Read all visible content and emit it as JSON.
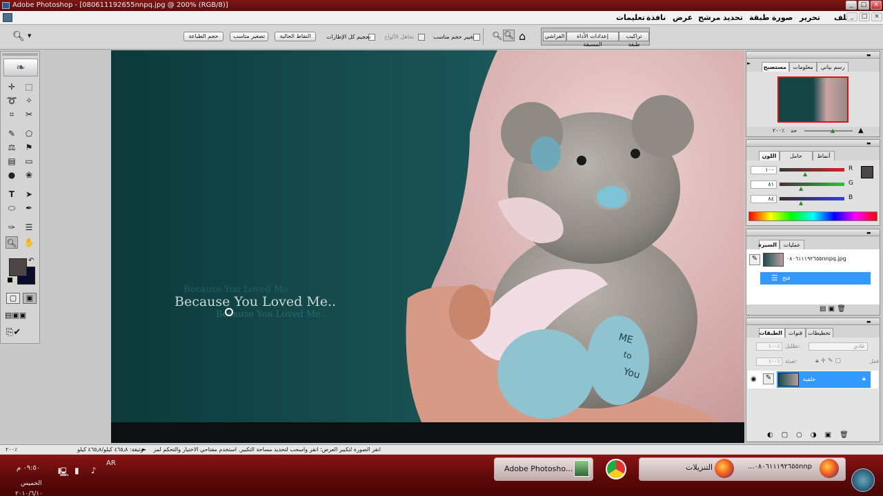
{
  "window": {
    "title": "Adobe Photoshop - [080611192655nnpq.jpg @ 200% (RGB/8)]",
    "min": "_",
    "max": "□",
    "close": "×"
  },
  "menu": {
    "items": [
      "ملف",
      "تحرير",
      "صورة",
      "طبقة",
      "تحديد",
      "مرشح",
      "عرض",
      "نافذة",
      "تعليمات"
    ]
  },
  "options": {
    "resize_windows_label": "تغيير حجم مناسب",
    "ignore_palettes_label": "تجاهل الألواح",
    "zoom_all_label": "تحجيم كل الإطارات",
    "actual_pixels": "النقاط الحالية",
    "fit_on_screen": "تصغير مناسب",
    "print_size": "حجم الطباعة",
    "tabs": [
      "تراكيب طبقة",
      "إعدادات الأداة المسبقة",
      "الفراشي"
    ]
  },
  "canvas": {
    "text_main": "Because You Loved Me..",
    "text_ghost_top": "Because You Loved Me..",
    "text_ghost_bottom": "Because You Loved Me.."
  },
  "navigator": {
    "tabs": [
      "مستصبح",
      "معلومات",
      "رسم بياني"
    ],
    "zoom": "٢٠٠٪",
    "zoom_label": "حد"
  },
  "color": {
    "tabs": [
      "اللون",
      "حامل الألوان",
      "أنماط"
    ],
    "r_label": "R",
    "r_value": "١٠٠",
    "g_label": "G",
    "g_value": "٨١",
    "b_label": "B",
    "b_value": "٨٤",
    "fg": "#4d4646",
    "bg": "#0b0b2c"
  },
  "history": {
    "tabs": [
      "السيرة",
      "عمليات"
    ],
    "snapshot": "٠٨٠٦١١١٩٢٦٥٥nnpq.jpg",
    "state": "فتح"
  },
  "layers": {
    "tabs": [
      "الطبقات",
      "قنوات",
      "تخطيطات"
    ],
    "blend_mode": "عادي",
    "opacity_label": "تظليل:",
    "opacity": "١٠٠٪",
    "lock_label": "قفل:",
    "fill_label": "تعبئة:",
    "fill": "١٠٠٪",
    "layer_name": "خلفية"
  },
  "status": {
    "zoom": "٢٠٠٪",
    "doc_info": "وثيقة: ٤٦٥٫٨ كيلو/٤٦٥٫٨ كيلو",
    "hint": "انقر الصورة لتكبير العرض؛ انقر واسحب لتحديد مساحة التكبير. استخدم مفتاحي الاختيار والتحكم لمزيد من الخيارات."
  },
  "taskbar": {
    "time": "٠٩:٥٠ م",
    "day": "الخميس",
    "date": "٢٠١٠/٦/١٠",
    "lang": "AR",
    "btn_photoshop": "Adobe Photosho...",
    "btn_downloads": "التنزيلات",
    "btn_file": "...٠٨٠٦١١١٩٢٦٥٥nnp"
  },
  "colors": {
    "title_bar": "#6e1212",
    "highlight": "#3399ff",
    "taskbar": "#7a1010"
  }
}
